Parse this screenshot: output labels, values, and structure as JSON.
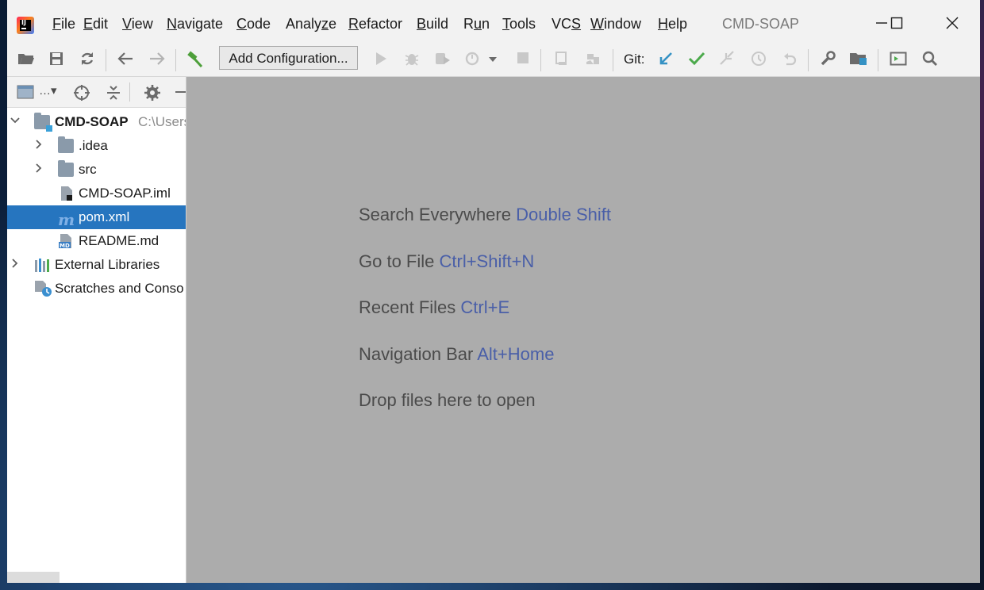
{
  "window": {
    "title": "CMD-SOAP"
  },
  "menu": {
    "items": [
      {
        "pre": "",
        "mn": "F",
        "post": "ile"
      },
      {
        "pre": "",
        "mn": "E",
        "post": "dit"
      },
      {
        "pre": "",
        "mn": "V",
        "post": "iew"
      },
      {
        "pre": "",
        "mn": "N",
        "post": "avigate"
      },
      {
        "pre": "",
        "mn": "C",
        "post": "ode"
      },
      {
        "pre": "Analy",
        "mn": "z",
        "post": "e"
      },
      {
        "pre": "",
        "mn": "R",
        "post": "efactor"
      },
      {
        "pre": "",
        "mn": "B",
        "post": "uild"
      },
      {
        "pre": "R",
        "mn": "u",
        "post": "n"
      },
      {
        "pre": "",
        "mn": "T",
        "post": "ools"
      },
      {
        "pre": "VC",
        "mn": "S",
        "post": ""
      },
      {
        "pre": "",
        "mn": "W",
        "post": "indow"
      },
      {
        "pre": "",
        "mn": "H",
        "post": "elp"
      }
    ]
  },
  "toolbar": {
    "add_configuration": "Add Configuration...",
    "git_label": "Git:"
  },
  "project_tree": {
    "root": {
      "name": "CMD-SOAP",
      "path": "C:\\Users"
    },
    "items": [
      {
        "label": ".idea"
      },
      {
        "label": "src"
      },
      {
        "label": "CMD-SOAP.iml"
      },
      {
        "label": "pom.xml"
      },
      {
        "label": "README.md"
      },
      {
        "label": "External Libraries"
      },
      {
        "label": "Scratches and Conso"
      }
    ]
  },
  "editor_hints": [
    {
      "text": "Search Everywhere",
      "shortcut": "Double Shift"
    },
    {
      "text": "Go to File",
      "shortcut": "Ctrl+Shift+N"
    },
    {
      "text": "Recent Files",
      "shortcut": "Ctrl+E"
    },
    {
      "text": "Navigation Bar",
      "shortcut": "Alt+Home"
    },
    {
      "text": "Drop files here to open",
      "shortcut": ""
    }
  ],
  "colors": {
    "selection": "#2675bf",
    "shortcut": "#4a5fa8",
    "git_update": "#3592c4",
    "git_commit": "#4caa4c",
    "build": "#4d9f3a"
  }
}
